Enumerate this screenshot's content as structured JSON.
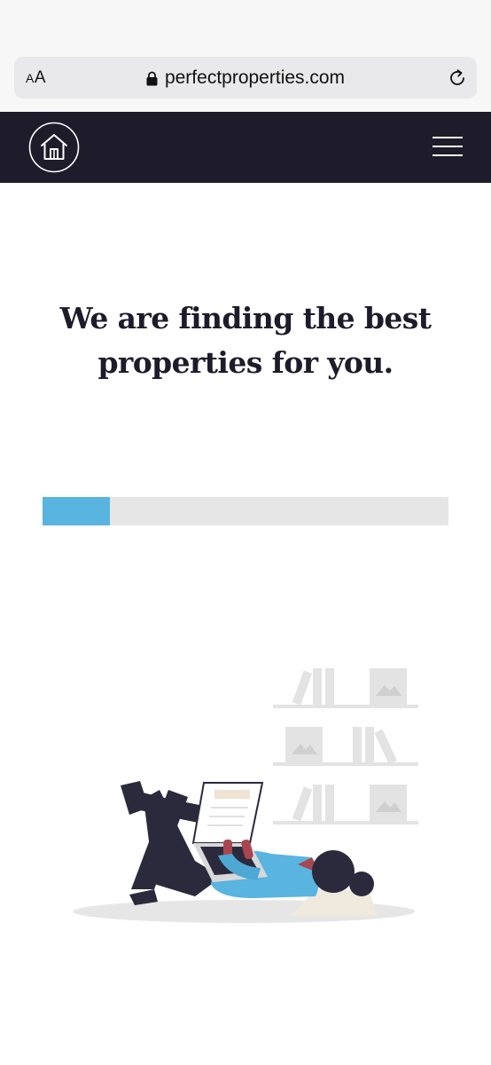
{
  "browser": {
    "text_size_small": "A",
    "text_size_large": "A",
    "url": "perfectproperties.com",
    "icons": [
      "lock-icon",
      "reload-icon"
    ]
  },
  "header": {
    "logo_icon": "house-icon",
    "menu_icon": "hamburger-menu-icon",
    "background_color": "#1e1b2a"
  },
  "main": {
    "headline_line1": "We are finding the best",
    "headline_line2": "properties for you.",
    "progress": {
      "fraction": 0.165,
      "fill_color": "#59b4e0",
      "track_color": "#e6e6e6"
    },
    "illustration": "person-lying-with-laptop-illustration"
  }
}
